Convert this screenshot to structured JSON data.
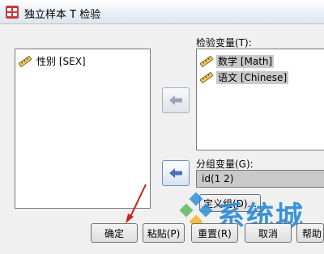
{
  "window": {
    "title": "独立样本 T 检验"
  },
  "source_variables": [
    {
      "label": "性别 [SEX]",
      "icon": "ruler-icon"
    }
  ],
  "test_variables": {
    "label": "检验变量(T):",
    "items": [
      {
        "label": "数学 [Math]",
        "icon": "ruler-icon"
      },
      {
        "label": "语文 [Chinese]",
        "icon": "ruler-icon"
      }
    ]
  },
  "grouping": {
    "label": "分组变量(G):",
    "value": "id(1 2)",
    "define_groups_label": "定义组(D)..."
  },
  "footer_buttons": {
    "ok": "确定",
    "paste": "粘贴(P)",
    "reset": "重置(R)",
    "cancel": "取消",
    "help": "帮助"
  },
  "watermark": {
    "text": "系统城"
  },
  "colors": {
    "accent": "#4f6fb5",
    "selection": "#c9c9c9",
    "watermark": "#2f8fd8",
    "annotation": "#d0201a"
  }
}
